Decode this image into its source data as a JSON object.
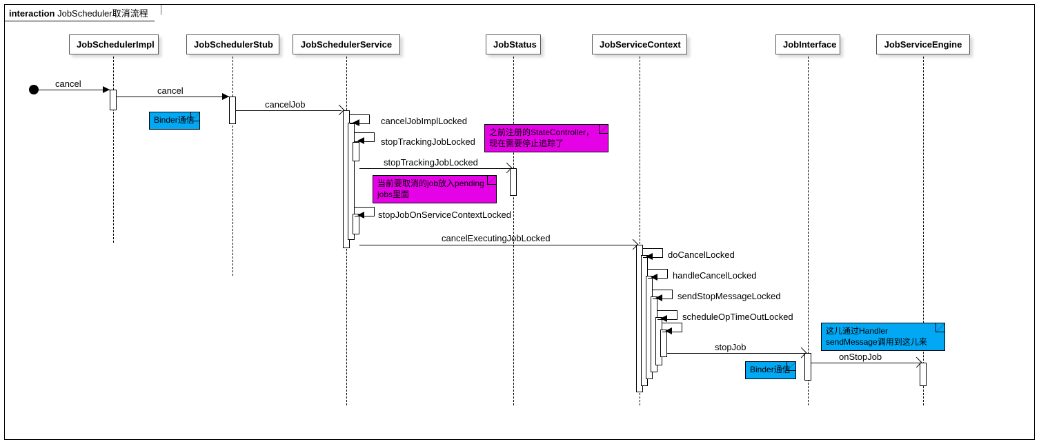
{
  "frame": {
    "keyword": "interaction",
    "title": "JobScheduler取消流程"
  },
  "participants": {
    "p1": "JobSchedulerImpl",
    "p2": "JobSchedulerStub",
    "p3": "JobSchedulerService",
    "p4": "JobStatus",
    "p5": "JobServiceContext",
    "p6": "JobInterface",
    "p7": "JobServiceEngine"
  },
  "messages": {
    "m1": "cancel",
    "m2": "cancel",
    "m3": "cancelJob",
    "m4": "cancelJobImplLocked",
    "m5": "stopTrackingJobLocked",
    "m6": "stopTrackingJobLocked",
    "m7": "stopJobOnServiceContextLocked",
    "m8": "cancelExecutingJobLocked",
    "m9": "doCancelLocked",
    "m10": "handleCancelLocked",
    "m11": "sendStopMessageLocked",
    "m12": "scheduleOpTimeOutLocked",
    "m13": "stopJob",
    "m14": "onStopJob"
  },
  "notes": {
    "n1": "Binder通信",
    "n2": "之前注册的StateController，\n现在需要停止追踪了",
    "n3": "当前要取消的job放入pending\njobs里面",
    "n4": "这儿通过Handler\nsendMessage调用到这儿来",
    "n5": "Binder通信"
  }
}
